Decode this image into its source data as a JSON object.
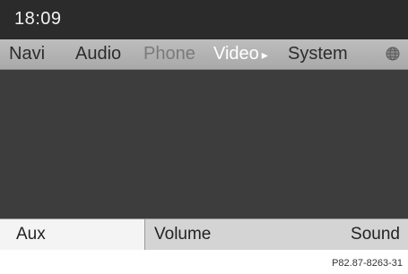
{
  "status": {
    "time": "18:09"
  },
  "menu": {
    "items": [
      {
        "label": "Navi"
      },
      {
        "label": "Audio"
      },
      {
        "label": "Phone"
      },
      {
        "label": "Video"
      },
      {
        "label": "System"
      }
    ],
    "active": "Video",
    "globe_icon": "globe-icon"
  },
  "softkeys": {
    "aux": "Aux",
    "volume": "Volume",
    "sound": "Sound"
  },
  "caption": "P82.87-8263-31",
  "colors": {
    "screen_bg": "#3a3a3a",
    "menubar_bg": "#b3b3b3",
    "bottombar_bg": "#d4d4d4",
    "selected_softkey_bg": "#f4f4f4"
  }
}
